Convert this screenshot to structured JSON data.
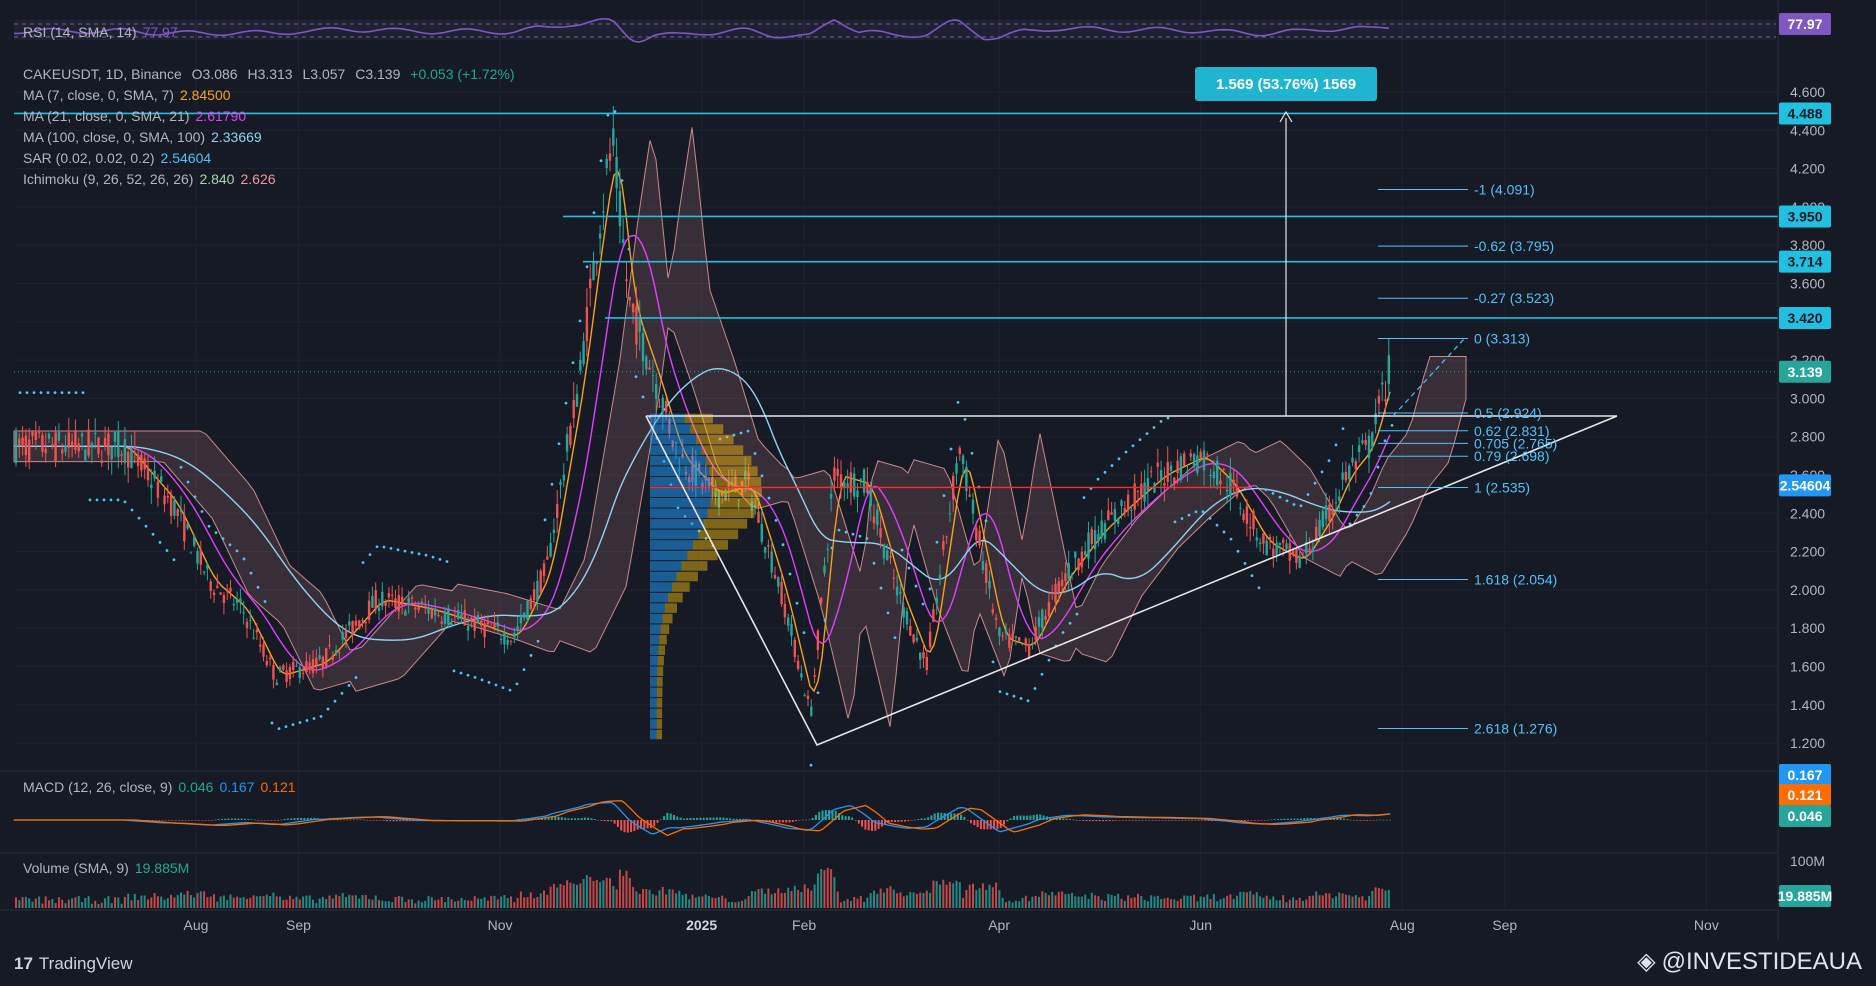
{
  "symbol_line": {
    "pair": "CAKEUSDT, 1D, Binance",
    "o": "O3.086",
    "h": "H3.313",
    "l": "L3.057",
    "c": "C3.139",
    "chg": "+0.053 (+1.72%)"
  },
  "indicators": [
    {
      "label": "MA (7, close, 0, SMA, 7)",
      "value": "2.84500",
      "color": "#f7a21b"
    },
    {
      "label": "MA (21, close, 0, SMA, 21)",
      "value": "2.61790",
      "color": "#e040fb"
    },
    {
      "label": "MA (100, close, 0, SMA, 100)",
      "value": "2.33669",
      "color": "#8fd3f4"
    },
    {
      "label": "SAR (0.02, 0.02, 0.2)",
      "value": "2.54604",
      "color": "#4fc3f7"
    },
    {
      "label": "Ichimoku (9, 26, 52, 26, 26)",
      "value": "2.840",
      "value2": "2.626",
      "color": "#a5d6a7",
      "color2": "#ef9a9a"
    }
  ],
  "rsi": {
    "label": "RSI (14, SMA, 14)",
    "value": "77.97"
  },
  "macd": {
    "label": "MACD (12, 26, close, 9)",
    "v1": "0.046",
    "v2": "0.167",
    "v3": "0.121"
  },
  "volume": {
    "label": "Volume (SMA, 9)",
    "value": "19.885M",
    "axis_label": "100M"
  },
  "measure_label": "1.569 (53.76%) 1569",
  "price_badges": [
    "4.488",
    "3.950",
    "3.714",
    "3.420",
    "3.139",
    "2.54604"
  ],
  "macd_badges": [
    "0.167",
    "0.121",
    "0.046"
  ],
  "volume_badge": "19.885M",
  "rsi_badge": "77.97",
  "fib_levels": [
    {
      "text": "-1 (4.091)",
      "price": 4.091
    },
    {
      "text": "-0.62 (3.795)",
      "price": 3.795
    },
    {
      "text": "-0.27 (3.523)",
      "price": 3.523
    },
    {
      "text": "0 (3.313)",
      "price": 3.313
    },
    {
      "text": "0.5 (2.924)",
      "price": 2.924
    },
    {
      "text": "0.62 (2.831)",
      "price": 2.831
    },
    {
      "text": "0.705 (2.765)",
      "price": 2.765
    },
    {
      "text": "0.79 (2.698)",
      "price": 2.698
    },
    {
      "text": "1 (2.535)",
      "price": 2.535
    },
    {
      "text": "1.618 (2.054)",
      "price": 2.054
    },
    {
      "text": "2.618 (1.276)",
      "price": 1.276
    }
  ],
  "chart_data": {
    "type": "line",
    "title": "",
    "xlabel": "",
    "ylabel": "",
    "ylim": [
      1.1,
      4.75
    ],
    "y_ticks": [
      "4.600",
      "4.400",
      "4.200",
      "4.000",
      "3.800",
      "3.600",
      "3.400",
      "3.200",
      "3.000",
      "2.800",
      "2.600",
      "2.400",
      "2.200",
      "2.000",
      "1.800",
      "1.600",
      "1.400",
      "1.200"
    ],
    "x_ticks": [
      "Aug",
      "Sep",
      "Nov",
      "2025",
      "Feb",
      "Apr",
      "Jun",
      "Aug",
      "Sep",
      "Nov"
    ],
    "horizontal_levels": [
      4.488,
      3.95,
      3.714,
      3.42
    ],
    "last_price": 3.139,
    "sar_value": 2.54604,
    "series": [
      {
        "name": "CAKEUSDT",
        "x": [
          "2024-07-10",
          "2024-07-25",
          "2024-08-05",
          "2024-08-15",
          "2024-08-25",
          "2024-09-08",
          "2024-09-25",
          "2024-10-10",
          "2024-10-25",
          "2024-11-05",
          "2024-11-15",
          "2024-11-25",
          "2024-12-01",
          "2024-12-05",
          "2024-12-10",
          "2024-12-18",
          "2024-12-25",
          "2025-01-05",
          "2025-01-15",
          "2025-01-25",
          "2025-02-03",
          "2025-02-10",
          "2025-02-20",
          "2025-03-01",
          "2025-03-10",
          "2025-03-20",
          "2025-04-01",
          "2025-04-10",
          "2025-04-20",
          "2025-05-01",
          "2025-05-10",
          "2025-05-20",
          "2025-06-01",
          "2025-06-10",
          "2025-06-20",
          "2025-07-01",
          "2025-07-10",
          "2025-07-15",
          "2025-07-22",
          "2025-07-28"
        ],
        "values": [
          2.75,
          2.45,
          2.05,
          1.9,
          1.55,
          1.62,
          1.95,
          1.9,
          1.82,
          1.75,
          2.1,
          3.1,
          3.9,
          4.35,
          3.5,
          3.1,
          2.7,
          2.5,
          2.55,
          2.0,
          1.35,
          2.6,
          2.55,
          2.0,
          1.6,
          2.75,
          1.75,
          1.7,
          2.05,
          2.3,
          2.45,
          2.6,
          2.7,
          2.55,
          2.25,
          2.15,
          2.4,
          2.6,
          2.75,
          3.139
        ]
      }
    ]
  }
}
